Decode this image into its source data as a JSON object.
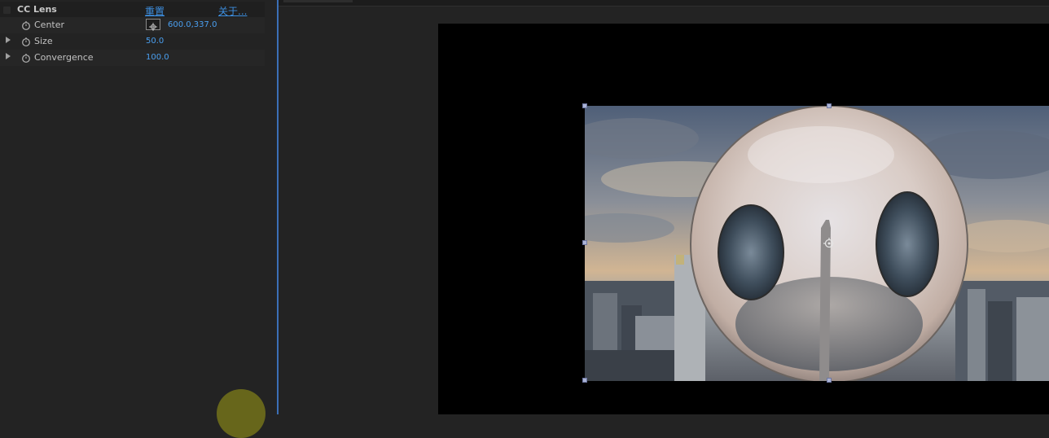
{
  "effect_controls": {
    "effect_name": "CC Lens",
    "reset_label": "重置",
    "about_label": "关于...",
    "properties": [
      {
        "label": "Center",
        "value": "600.0,337.0"
      },
      {
        "label": "Size",
        "value": "50.0"
      },
      {
        "label": "Convergence",
        "value": "100.0"
      }
    ]
  },
  "colors": {
    "panel_bg": "#232323",
    "value_blue": "#4a9ff0",
    "link_blue": "#3d8fe0",
    "panel_divider": "#3b6fb6",
    "selection_handle": "#aab3d6"
  },
  "icons": {
    "stopwatch": "stopwatch-icon",
    "twirl": "twirl-triangle-icon",
    "target": "crosshair-target-icon",
    "anchor": "anchor-point-icon"
  }
}
